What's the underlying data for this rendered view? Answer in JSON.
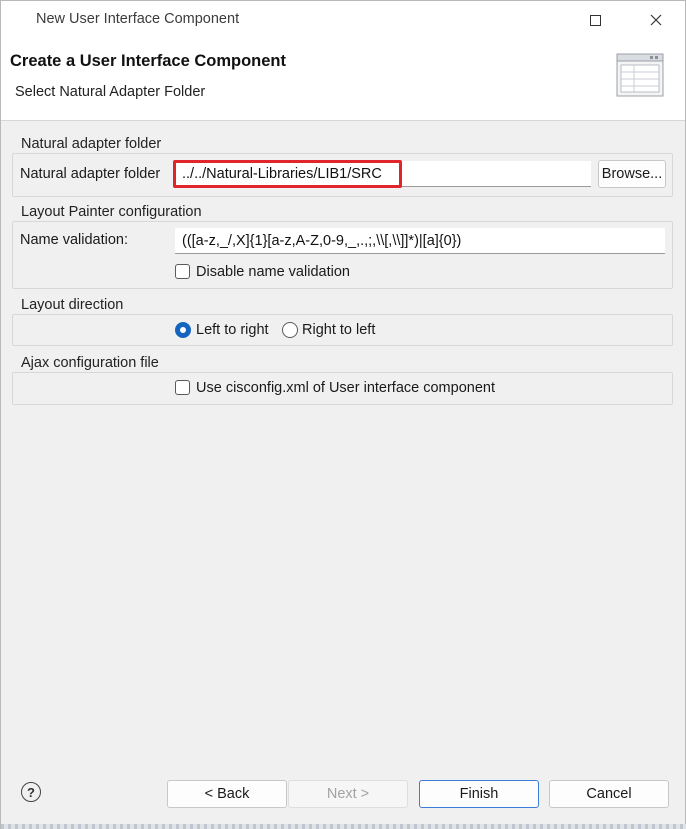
{
  "window": {
    "title": "New User Interface Component"
  },
  "banner": {
    "heading": "Create a User Interface Component",
    "subheading": "Select Natural Adapter Folder"
  },
  "adapter_group": {
    "title": "Natural adapter folder",
    "field_label": "Natural adapter folder",
    "field_value": "../../Natural-Libraries/LIB1/SRC",
    "browse_label": "Browse..."
  },
  "painter_group": {
    "title": "Layout Painter configuration",
    "validation_label": "Name validation:",
    "validation_value": "(([a-z,_/,X]{1}[a-z,A-Z,0-9,_,.,;,\\\\[,\\\\]]*)|[a]{0})",
    "disable_label": "Disable name validation",
    "disable_checked": false
  },
  "direction_group": {
    "title": "Layout direction",
    "options": [
      {
        "label": "Left to right",
        "selected": true
      },
      {
        "label": "Right to left",
        "selected": false
      }
    ]
  },
  "ajax_group": {
    "title": "Ajax configuration file",
    "checkbox_label": "Use cisconfig.xml of User interface component",
    "checked": false
  },
  "buttons": {
    "back": "< Back",
    "next": "Next >",
    "finish": "Finish",
    "cancel": "Cancel"
  },
  "help_glyph": "?",
  "colors": {
    "highlight": "#e0262b",
    "accent": "#1565c0"
  }
}
